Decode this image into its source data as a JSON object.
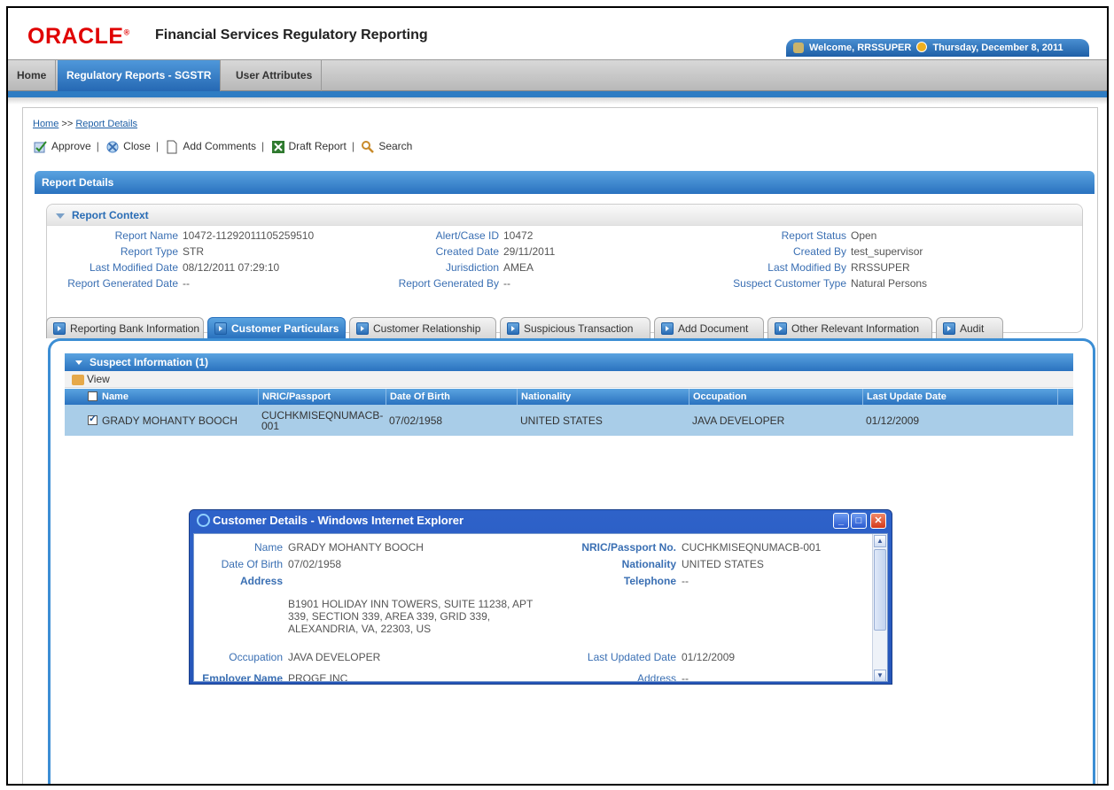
{
  "header": {
    "logo_text": "ORACLE",
    "app_title": "Financial Services Regulatory Reporting",
    "welcome": "Welcome, RRSSUPER",
    "date": "Thursday, December 8, 2011"
  },
  "nav": {
    "items": [
      {
        "label": "Home"
      },
      {
        "label": "Regulatory Reports - SGSTR",
        "active": true
      },
      {
        "label": "User Attributes"
      }
    ]
  },
  "breadcrumb": {
    "home": "Home",
    "separator": ">>",
    "current": "Report Details"
  },
  "toolbar": {
    "approve": "Approve",
    "close": "Close",
    "add_comments": "Add Comments",
    "draft_report": "Draft Report",
    "search": "Search"
  },
  "section_title": "Report Details",
  "report_context": {
    "title": "Report Context",
    "fields": {
      "report_name": {
        "label": "Report Name",
        "value": "10472-11292011105259510"
      },
      "report_type": {
        "label": "Report Type",
        "value": "STR"
      },
      "last_modified_date": {
        "label": "Last Modified Date",
        "value": "08/12/2011 07:29:10"
      },
      "report_generated_date": {
        "label": "Report Generated Date",
        "value": "--"
      },
      "alert_case_id": {
        "label": "Alert/Case ID",
        "value": "10472"
      },
      "created_date": {
        "label": "Created Date",
        "value": "29/11/2011"
      },
      "jurisdiction": {
        "label": "Jurisdiction",
        "value": "AMEA"
      },
      "report_generated_by": {
        "label": "Report Generated By",
        "value": "--"
      },
      "report_status": {
        "label": "Report Status",
        "value": "Open"
      },
      "created_by": {
        "label": "Created By",
        "value": "test_supervisor"
      },
      "last_modified_by": {
        "label": "Last Modified By",
        "value": "RRSSUPER"
      },
      "suspect_customer_type": {
        "label": "Suspect Customer Type",
        "value": "Natural Persons"
      }
    }
  },
  "tabs": [
    {
      "label": "Reporting Bank Information"
    },
    {
      "label": "Customer Particulars",
      "active": true
    },
    {
      "label": "Customer Relationship"
    },
    {
      "label": "Suspicious Transaction"
    },
    {
      "label": "Add Document"
    },
    {
      "label": "Other Relevant Information"
    },
    {
      "label": "Audit"
    }
  ],
  "suspect_info": {
    "title": "Suspect Information (1)",
    "view_label": "View",
    "columns": [
      "Name",
      "NRIC/Passport",
      "Date Of Birth",
      "Nationality",
      "Occupation",
      "Last Update Date"
    ],
    "rows": [
      {
        "checked": true,
        "name": "GRADY MOHANTY BOOCH",
        "nric": "CUCHKMISEQNUMACB-001",
        "dob": "07/02/1958",
        "nationality": "UNITED STATES",
        "occupation": "JAVA DEVELOPER",
        "last_update": "01/12/2009"
      }
    ]
  },
  "popup": {
    "title": "Customer Details - Windows Internet Explorer",
    "fields": {
      "name": {
        "label": "Name",
        "value": "GRADY MOHANTY BOOCH"
      },
      "dob": {
        "label": "Date Of Birth",
        "value": "07/02/1958"
      },
      "address": {
        "label": "Address",
        "value": "B1901 HOLIDAY INN TOWERS, SUITE 11238, APT 339, SECTION 339, AREA 339, GRID 339, ALEXANDRIA, VA, 22303, US"
      },
      "occupation": {
        "label": "Occupation",
        "value": "JAVA DEVELOPER"
      },
      "employer_name": {
        "label": "Employer Name",
        "value": "PROGE INC"
      },
      "nric": {
        "label": "NRIC/Passport No.",
        "value": "CUCHKMISEQNUMACB-001"
      },
      "nationality": {
        "label": "Nationality",
        "value": "UNITED STATES"
      },
      "telephone": {
        "label": "Telephone",
        "value": "--"
      },
      "last_updated_date": {
        "label": "Last Updated Date",
        "value": "01/12/2009"
      },
      "employer_address": {
        "label": "Address",
        "value": "--"
      }
    }
  },
  "colors": {
    "oracle_red": "#e00000",
    "accent_blue": "#2e7cc3",
    "label_blue": "#3a6fb3",
    "row_selected": "#a9cde8"
  }
}
